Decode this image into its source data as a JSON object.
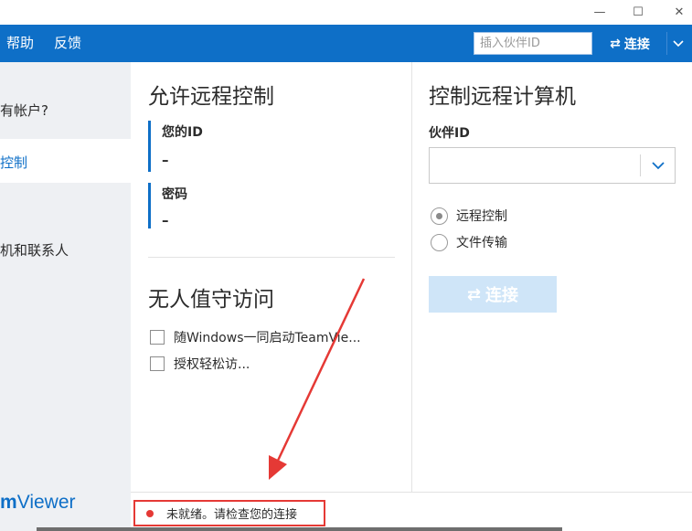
{
  "window": {
    "minimize_glyph": "—",
    "maximize_glyph": "☐",
    "close_glyph": "✕"
  },
  "menubar": {
    "help": "帮助",
    "feedback": "反馈",
    "partner_id_placeholder": "插入伙伴ID",
    "connect_label": "连接"
  },
  "sidebar": {
    "account_link": "有帐户?",
    "active_item": "控制",
    "contacts_item": "机和联系人",
    "logo_bold": "m",
    "logo_rest": "Viewer"
  },
  "allow": {
    "title": "允许远程控制",
    "id_label": "您的ID",
    "id_value": "–",
    "password_label": "密码",
    "password_value": "–"
  },
  "unattended": {
    "title": "无人值守访问",
    "options": [
      {
        "label": "随Windows一同启动TeamVie...",
        "checked": false
      },
      {
        "label": "授权轻松访...",
        "checked": false
      }
    ]
  },
  "control": {
    "title": "控制远程计算机",
    "partner_id_label": "伙伴ID",
    "partner_id_value": "",
    "modes": [
      {
        "label": "远程控制",
        "selected": true
      },
      {
        "label": "文件传输",
        "selected": false
      }
    ],
    "connect_label": "连接"
  },
  "status": {
    "text": "未就绪。请检查您的连接",
    "state_color": "#e53935"
  },
  "colors": {
    "brand_blue": "#0e6fc7",
    "annotation_red": "#e53935",
    "disabled_button": "#cfe5f8"
  }
}
